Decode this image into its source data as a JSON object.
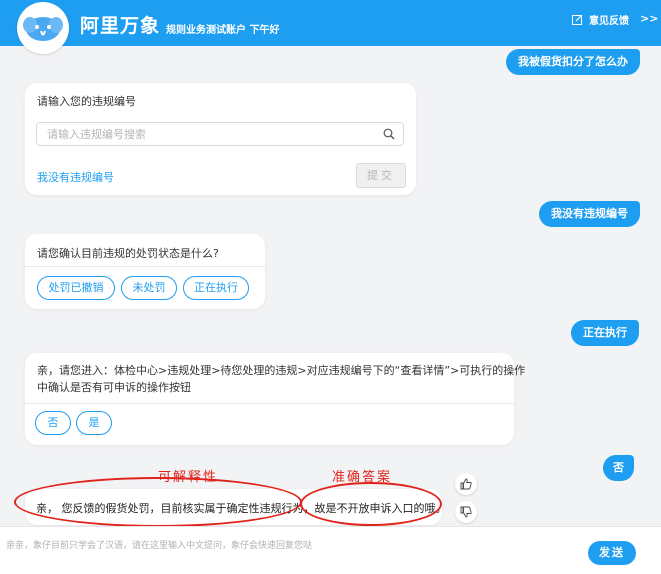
{
  "header": {
    "title": "阿里万象",
    "subtitle": "规则业务测试账户 下午好",
    "feedback_label": "意见反馈",
    "collapse_label": ">>"
  },
  "messages": {
    "user1": "我被假货扣分了怎么办",
    "card1": {
      "prompt": "请输入您的违规编号",
      "search_placeholder": "请输入违规编号搜索",
      "search_value": "",
      "no_number_link": "我没有违规编号",
      "submit_label": "提交"
    },
    "user2": "我没有违规编号",
    "card2": {
      "question": "请您确认目前违规的处罚状态是什么?",
      "options": [
        "处罚已撤销",
        "未处罚",
        "正在执行"
      ]
    },
    "user3": "正在执行",
    "card3": {
      "text_line1": "亲，请您进入：体检中心>违规处理>待您处理的违规>对应违规编号下的“查看详情”>可执行的操作",
      "text_line2": "中确认是否有可申诉的操作按钮",
      "options": [
        "否",
        "是"
      ]
    },
    "user4": "否",
    "card4": {
      "text_part1": "亲，  您反馈的假货处罚，目前核实属于确定性违规行为，",
      "text_part2": "故是不开放申诉入口的哦。"
    }
  },
  "annotations": {
    "left": "可解释性",
    "right": "准确答案"
  },
  "input": {
    "placeholder": "亲亲，象仔目前只学会了汉语，请在这里输入中文提问，象仔会快速回复您哒",
    "value": "",
    "send_label": "发送"
  },
  "colors": {
    "accent": "#1e9ef0",
    "annotation": "#e0231b"
  }
}
